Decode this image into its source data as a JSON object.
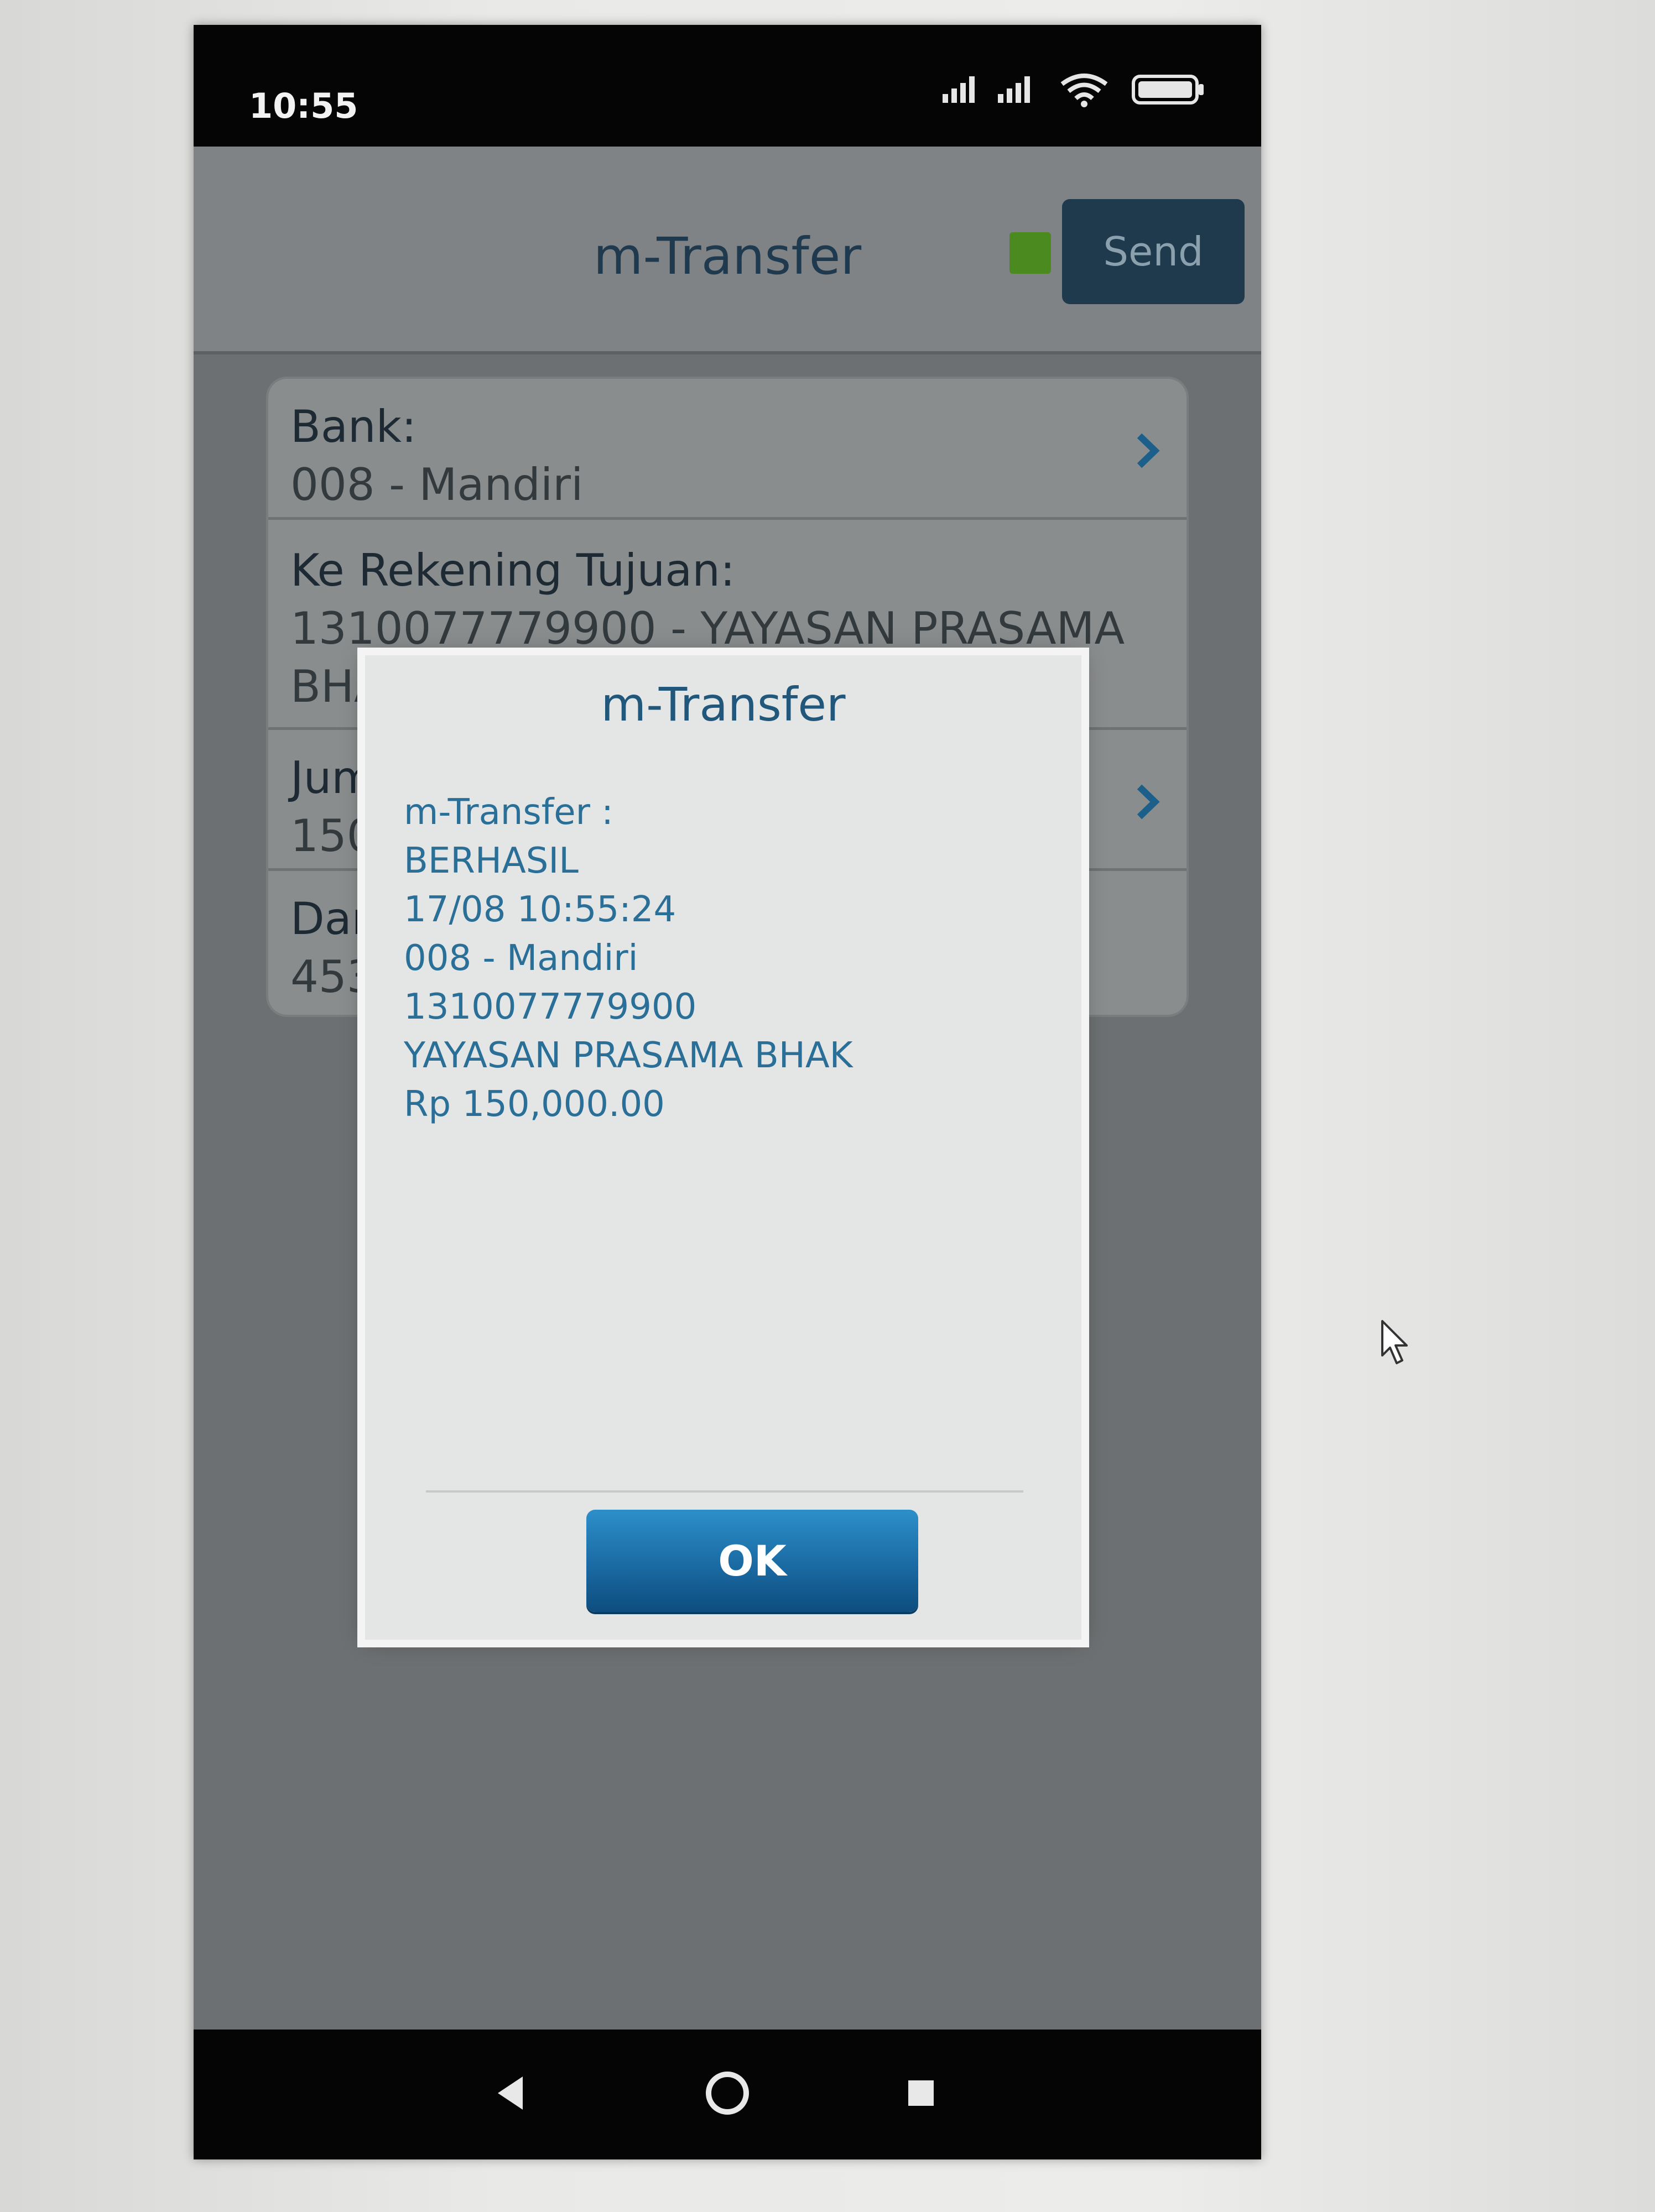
{
  "status_bar": {
    "time": "10:55",
    "icons": [
      "signal-icon",
      "signal-icon",
      "wifi-icon",
      "battery-icon"
    ]
  },
  "header": {
    "title": "m-Transfer",
    "indicator_color": "#4b8a1f",
    "send_label": "Send"
  },
  "form": {
    "rows": [
      {
        "label": "Bank:",
        "value": "008 - Mandiri"
      },
      {
        "label": "Ke Rekening Tujuan:",
        "value": "1310077779900 - YAYASAN PRASAMA",
        "value2": "BHA"
      },
      {
        "label": "Jum",
        "value": "150"
      },
      {
        "label": "Dar",
        "value": "453"
      }
    ]
  },
  "dialog": {
    "title": "m-Transfer",
    "lines": [
      "m-Transfer :",
      "BERHASIL",
      "17/08 10:55:24",
      "008 - Mandiri",
      "1310077779900",
      "YAYASAN PRASAMA BHAK",
      "Rp 150,000.00"
    ],
    "ok_label": "OK"
  },
  "nav": [
    "back-icon",
    "home-icon",
    "recents-icon"
  ],
  "colors": {
    "accent": "#20577a",
    "message_text": "#2a6f98",
    "button": "#1a6aa3"
  }
}
